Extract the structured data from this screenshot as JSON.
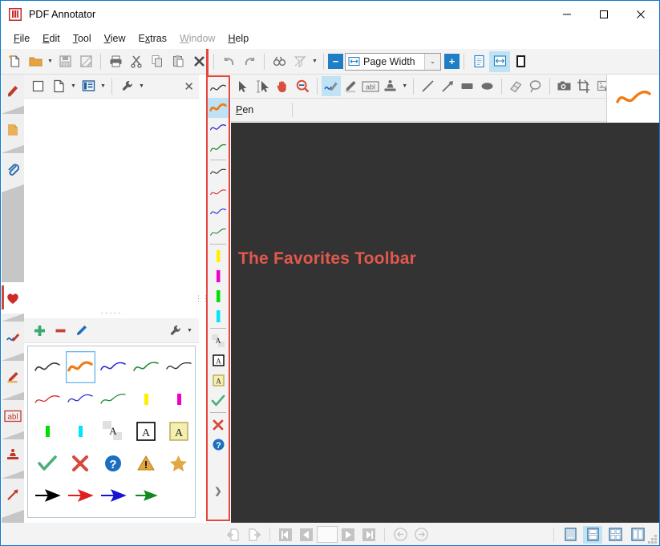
{
  "window": {
    "title": "PDF Annotator",
    "minimize_label": "—",
    "maximize_label": "□",
    "close_label": "✕"
  },
  "menubar": {
    "items": [
      {
        "label": "File",
        "accel": "F",
        "disabled": false
      },
      {
        "label": "Edit",
        "accel": "E",
        "disabled": false
      },
      {
        "label": "Tool",
        "accel": "T",
        "disabled": false
      },
      {
        "label": "View",
        "accel": "V",
        "disabled": false
      },
      {
        "label": "Extras",
        "accel": "x",
        "disabled": false
      },
      {
        "label": "Window",
        "accel": "W",
        "disabled": true
      },
      {
        "label": "Help",
        "accel": "H",
        "disabled": false
      }
    ]
  },
  "main_toolbar": {
    "buttons": [
      {
        "name": "new-document-icon",
        "label": "New"
      },
      {
        "name": "open-folder-icon",
        "label": "Open"
      },
      {
        "name": "save-icon",
        "label": "Save"
      },
      {
        "name": "save-as-icon",
        "label": "Save As"
      },
      {
        "name": "print-icon",
        "label": "Print"
      },
      {
        "name": "cut-icon",
        "label": "Cut"
      },
      {
        "name": "copy-icon",
        "label": "Copy"
      },
      {
        "name": "paste-icon",
        "label": "Paste"
      },
      {
        "name": "delete-icon",
        "label": "Delete"
      },
      {
        "name": "undo-icon",
        "label": "Undo"
      },
      {
        "name": "redo-icon",
        "label": "Redo"
      },
      {
        "name": "find-icon",
        "label": "Find"
      },
      {
        "name": "sort-icon",
        "label": "Sort"
      }
    ],
    "zoom_out_label": "−",
    "zoom_in_label": "+",
    "zoom_value": "Page Width",
    "zoom_dropdown_label": "⌄",
    "view_modes": [
      {
        "name": "single-page-view-icon",
        "selected": false
      },
      {
        "name": "page-width-view-icon",
        "selected": true
      },
      {
        "name": "full-page-view-icon",
        "selected": false
      }
    ]
  },
  "sidebar": {
    "group_a": [
      {
        "name": "sidebar-item-bookmarks",
        "icon": "bookmark-icon",
        "selected": false
      },
      {
        "name": "sidebar-item-pages",
        "icon": "page-note-icon",
        "selected": false
      },
      {
        "name": "sidebar-item-attachments",
        "icon": "paperclip-icon",
        "selected": false
      }
    ],
    "group_b": [
      {
        "name": "sidebar-item-favorites",
        "icon": "heart-icon",
        "selected": true
      },
      {
        "name": "sidebar-item-pen",
        "icon": "pen-icon",
        "selected": false
      },
      {
        "name": "sidebar-item-highlighter",
        "icon": "highlighter-icon",
        "selected": false
      },
      {
        "name": "sidebar-item-text",
        "icon": "abl-text-icon",
        "selected": false
      },
      {
        "name": "sidebar-item-stamps",
        "icon": "stamp-icon",
        "selected": false
      },
      {
        "name": "sidebar-item-arrows",
        "icon": "arrow-icon",
        "selected": false
      }
    ]
  },
  "left_panel": {
    "toolbar": [
      {
        "name": "blank-page-button",
        "icon": "empty-square-icon",
        "has_caret": false
      },
      {
        "name": "new-document-button",
        "icon": "document-icon",
        "has_caret": true
      },
      {
        "name": "library-button",
        "icon": "book-icon",
        "has_caret": true,
        "selected": true
      },
      {
        "name": "tools-button",
        "icon": "wrench-icon",
        "has_caret": true
      }
    ],
    "close_label": "✕",
    "splitter_dots": "·····"
  },
  "favorites_panel": {
    "toolbar": [
      {
        "name": "add-favorite-button",
        "icon": "plus-icon",
        "color": "#3aaa6e"
      },
      {
        "name": "remove-favorite-button",
        "icon": "minus-icon",
        "color": "#c1443b"
      },
      {
        "name": "edit-favorite-button",
        "icon": "pencil-icon",
        "color": "#1d6fc1"
      },
      {
        "name": "favorites-options-button",
        "icon": "wrench-icon",
        "color": "#555555",
        "has_caret": true
      }
    ],
    "grid": [
      [
        {
          "name": "favorite-pen-black",
          "kind": "stroke",
          "color": "#333333",
          "selected": false
        },
        {
          "name": "favorite-pen-orange",
          "kind": "stroke",
          "color": "#f07b16",
          "selected": true,
          "thick": true
        },
        {
          "name": "favorite-pen-blue",
          "kind": "stroke",
          "color": "#2a2ad6",
          "selected": false
        },
        {
          "name": "favorite-pen-green",
          "kind": "stroke",
          "color": "#1d8a2c",
          "selected": false
        },
        {
          "name": "favorite-pen-black-2",
          "kind": "stroke",
          "color": "#333333",
          "selected": false
        }
      ],
      [
        {
          "name": "favorite-pen-red-thin",
          "kind": "stroke",
          "color": "#d32f2f",
          "selected": false
        },
        {
          "name": "favorite-pen-blue-thin",
          "kind": "stroke",
          "color": "#2a2ad6",
          "selected": false
        },
        {
          "name": "favorite-pen-green-thin",
          "kind": "stroke",
          "color": "#1d8a2c",
          "selected": false
        },
        {
          "name": "favorite-highlighter-yellow",
          "kind": "marker",
          "color": "#ffee00",
          "selected": false
        },
        {
          "name": "favorite-highlighter-magenta",
          "kind": "marker",
          "color": "#ef00c8",
          "selected": false
        }
      ],
      [
        {
          "name": "favorite-highlighter-green",
          "kind": "marker",
          "color": "#00e000",
          "selected": false
        },
        {
          "name": "favorite-highlighter-cyan",
          "kind": "marker",
          "color": "#00e5ff",
          "selected": false
        },
        {
          "name": "favorite-text-plain",
          "kind": "textA",
          "style": "plain",
          "selected": false
        },
        {
          "name": "favorite-text-boxed",
          "kind": "textA",
          "style": "boxed",
          "selected": false
        },
        {
          "name": "favorite-text-note",
          "kind": "textA",
          "style": "note",
          "selected": false
        }
      ],
      [
        {
          "name": "favorite-stamp-check",
          "kind": "glyph",
          "glyph": "check",
          "color": "#4caf7d",
          "selected": false
        },
        {
          "name": "favorite-stamp-cross",
          "kind": "glyph",
          "glyph": "cross",
          "color": "#d6483c",
          "selected": false
        },
        {
          "name": "favorite-stamp-question",
          "kind": "glyph",
          "glyph": "question",
          "color": "#1b6fc0",
          "selected": false
        },
        {
          "name": "favorite-stamp-warning",
          "kind": "glyph",
          "glyph": "warning",
          "color": "#e8a33d",
          "selected": false
        },
        {
          "name": "favorite-stamp-star",
          "kind": "glyph",
          "glyph": "star",
          "color": "#e2a845",
          "selected": false
        }
      ],
      [
        {
          "name": "favorite-arrow-black",
          "kind": "arrow",
          "color": "#000000",
          "selected": false
        },
        {
          "name": "favorite-arrow-red",
          "kind": "arrow",
          "color": "#e02020",
          "selected": false
        },
        {
          "name": "favorite-arrow-blue",
          "kind": "arrow",
          "color": "#1414d2",
          "selected": false
        },
        {
          "name": "favorite-arrow-green",
          "kind": "arrow",
          "color": "#0f8a1f",
          "selected": false
        }
      ]
    ]
  },
  "favorites_toolbar": {
    "highlight_color": "#e8463c",
    "more_label": "❯",
    "items": [
      {
        "name": "favbar-pen-black",
        "kind": "stroke",
        "color": "#333333",
        "selected": false
      },
      {
        "name": "favbar-pen-orange",
        "kind": "stroke",
        "color": "#f07b16",
        "selected": true,
        "thick": true
      },
      {
        "name": "favbar-pen-blue",
        "kind": "stroke",
        "color": "#2a2ad6",
        "selected": false
      },
      {
        "name": "favbar-pen-green",
        "kind": "stroke",
        "color": "#1d8a2c",
        "selected": false
      },
      {
        "name": "sep1",
        "kind": "separator"
      },
      {
        "name": "favbar-pen-black-2",
        "kind": "stroke",
        "color": "#333333",
        "selected": false
      },
      {
        "name": "favbar-pen-red",
        "kind": "stroke",
        "color": "#d32f2f",
        "selected": false
      },
      {
        "name": "favbar-pen-blue-2",
        "kind": "stroke",
        "color": "#2a2ad6",
        "selected": false
      },
      {
        "name": "favbar-pen-green-2",
        "kind": "stroke",
        "color": "#1d8a2c",
        "selected": false
      },
      {
        "name": "sep2",
        "kind": "separator"
      },
      {
        "name": "favbar-highlighter-yellow",
        "kind": "marker",
        "color": "#ffee00",
        "selected": false
      },
      {
        "name": "favbar-highlighter-magenta",
        "kind": "marker",
        "color": "#ef00c8",
        "selected": false
      },
      {
        "name": "favbar-highlighter-green",
        "kind": "marker",
        "color": "#00e000",
        "selected": false
      },
      {
        "name": "favbar-highlighter-cyan",
        "kind": "marker",
        "color": "#00e5ff",
        "selected": false
      },
      {
        "name": "sep3",
        "kind": "separator"
      },
      {
        "name": "favbar-text-plain",
        "kind": "textA",
        "style": "plain",
        "selected": false
      },
      {
        "name": "favbar-text-boxed",
        "kind": "textA",
        "style": "boxed",
        "selected": false
      },
      {
        "name": "favbar-text-note",
        "kind": "textA",
        "style": "note",
        "selected": false
      },
      {
        "name": "favbar-stamp-check",
        "kind": "glyph",
        "glyph": "check",
        "color": "#4caf7d",
        "selected": false
      },
      {
        "name": "sep4",
        "kind": "separator"
      },
      {
        "name": "favbar-stamp-cross",
        "kind": "glyph",
        "glyph": "cross",
        "color": "#d6483c",
        "selected": false
      },
      {
        "name": "favbar-stamp-question",
        "kind": "glyph",
        "glyph": "question",
        "color": "#1b6fc0",
        "selected": false
      }
    ]
  },
  "annotation_toolbar": {
    "tools": [
      {
        "name": "select-arrow-tool",
        "icon": "cursor-arrow-icon",
        "selected": false
      },
      {
        "name": "select-text-tool",
        "icon": "text-cursor-icon",
        "selected": false
      },
      {
        "name": "hand-tool",
        "icon": "hand-icon",
        "selected": false
      },
      {
        "name": "zoom-tool",
        "icon": "magnifier-icon",
        "selected": false
      },
      {
        "name": "pen-tool",
        "icon": "pen-icon",
        "selected": true
      },
      {
        "name": "highlighter-tool",
        "icon": "highlighter-icon",
        "selected": false
      },
      {
        "name": "text-tool",
        "icon": "abl-text-icon",
        "selected": false
      },
      {
        "name": "stamp-tool",
        "icon": "stamp-icon",
        "selected": false,
        "has_caret": true
      },
      {
        "name": "line-tool",
        "icon": "line-icon",
        "selected": false
      },
      {
        "name": "arrow-tool",
        "icon": "arrow-icon",
        "selected": false
      },
      {
        "name": "rectangle-tool",
        "icon": "rectangle-icon",
        "selected": false
      },
      {
        "name": "ellipse-tool",
        "icon": "ellipse-icon",
        "selected": false
      },
      {
        "name": "eraser-tool",
        "icon": "eraser-icon",
        "selected": false
      },
      {
        "name": "lasso-tool",
        "icon": "lasso-icon",
        "selected": false
      },
      {
        "name": "snapshot-tool",
        "icon": "camera-icon",
        "selected": false
      },
      {
        "name": "crop-tool",
        "icon": "crop-icon",
        "selected": false
      },
      {
        "name": "insert-image-tool",
        "icon": "add-image-icon",
        "selected": false,
        "has_caret": true
      }
    ],
    "overflow_label": "⌄",
    "preview_color": "#f07b16"
  },
  "tool_options_bar": {
    "label": "Pen",
    "accel": "P"
  },
  "document": {
    "background_color": "#333333",
    "title_text": "The Favorites Toolbar",
    "title_color": "#e2584e"
  },
  "statusbar": {
    "nav_buttons": [
      {
        "name": "previous-view-button",
        "icon": "page-back-icon"
      },
      {
        "name": "next-view-button",
        "icon": "page-forward-icon"
      }
    ],
    "page_buttons": [
      {
        "name": "first-page-button",
        "icon": "first-page-icon"
      },
      {
        "name": "previous-page-button",
        "icon": "previous-page-icon"
      }
    ],
    "page_number": "",
    "page_buttons_right": [
      {
        "name": "next-page-button",
        "icon": "next-page-icon"
      },
      {
        "name": "last-page-button",
        "icon": "last-page-icon"
      }
    ],
    "history_buttons": [
      {
        "name": "back-button",
        "icon": "circle-back-icon"
      },
      {
        "name": "forward-button",
        "icon": "circle-forward-icon"
      }
    ],
    "layout_buttons": [
      {
        "name": "single-page-layout-button",
        "icon": "single-page-icon",
        "selected": false
      },
      {
        "name": "continuous-layout-button",
        "icon": "continuous-icon",
        "selected": true
      },
      {
        "name": "two-page-layout-button",
        "icon": "two-page-icon",
        "selected": false
      },
      {
        "name": "two-page-continuous-button",
        "icon": "two-page-cont-icon",
        "selected": false
      }
    ]
  }
}
